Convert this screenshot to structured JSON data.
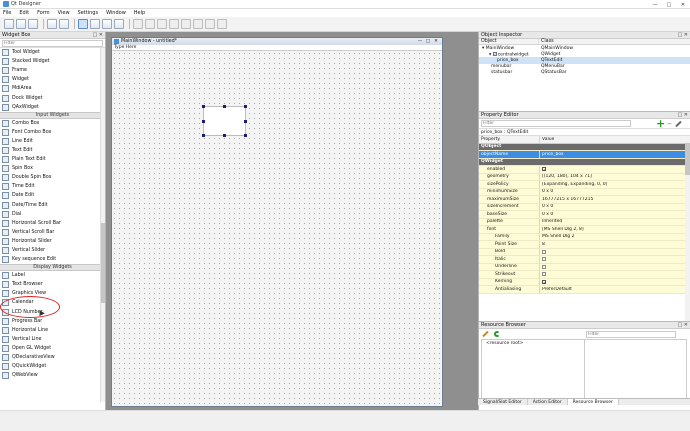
{
  "app": {
    "title": "Qt Designer"
  },
  "menu": [
    "File",
    "Edit",
    "Form",
    "View",
    "Settings",
    "Window",
    "Help"
  ],
  "widget_box": {
    "title": "Widget Box",
    "filter_placeholder": "Filter",
    "items_top": [
      "Tool Widget",
      "Stacked Widget",
      "Frame",
      "Widget",
      "MdiArea",
      "Dock Widget",
      "QAxWidget"
    ],
    "input_category": "Input Widgets",
    "input_items": [
      "Combo Box",
      "Font Combo Box",
      "Line Edit",
      "Text Edit",
      "Plain Text Edit",
      "Spin Box",
      "Double Spin Box",
      "Time Edit",
      "Date Edit",
      "Date/Time Edit",
      "Dial",
      "Horizontal Scroll Bar",
      "Vertical Scroll Bar",
      "Horizontal Slider",
      "Vertical Slider",
      "Key sequence Edit"
    ],
    "display_category": "Display Widgets",
    "display_items": [
      "Label",
      "Text Browser",
      "Graphics View",
      "Calendar",
      "LCD Number",
      "Progress Bar",
      "Horizontal Line",
      "Vertical Line",
      "Open GL Widget",
      "QDeclarativeView",
      "QQuickWidget",
      "QWebView"
    ]
  },
  "form": {
    "title": "MainWindow - untitled*",
    "type_here": "Type Here"
  },
  "object_inspector": {
    "title": "Object Inspector",
    "col_object": "Object",
    "col_class": "Class",
    "rows": [
      {
        "object": "MainWindow",
        "class": "QMainWindow"
      },
      {
        "object": "centralwidget",
        "class": "QWidget"
      },
      {
        "object": "price_box",
        "class": "QTextEdit"
      },
      {
        "object": "menubar",
        "class": "QMenuBar"
      },
      {
        "object": "statusbar",
        "class": "QStatusBar"
      }
    ]
  },
  "property_editor": {
    "title": "Property Editor",
    "filter_placeholder": "Filter",
    "object_line": "price_box : QTextEdit",
    "col_property": "Property",
    "col_value": "Value",
    "rows": [
      {
        "name": "QObject",
        "value": "",
        "kind": "cls"
      },
      {
        "name": "objectName",
        "value": "price_box",
        "kind": "sel"
      },
      {
        "name": "QWidget",
        "value": "",
        "kind": "cls"
      },
      {
        "name": "enabled",
        "value": "",
        "kind": "yellow",
        "check": true
      },
      {
        "name": "geometry",
        "value": "[(120, 180), 104 x 71]",
        "kind": "yellow"
      },
      {
        "name": "sizePolicy",
        "value": "[Expanding, Expanding, 0, 0]",
        "kind": "yellow"
      },
      {
        "name": "minimumSize",
        "value": "0 x 0",
        "kind": "yellow"
      },
      {
        "name": "maximumSize",
        "value": "16777215 x 16777215",
        "kind": "yellow"
      },
      {
        "name": "sizeIncrement",
        "value": "0 x 0",
        "kind": "yellow"
      },
      {
        "name": "baseSize",
        "value": "0 x 0",
        "kind": "yellow"
      },
      {
        "name": "palette",
        "value": "Inherited",
        "kind": "yellow"
      },
      {
        "name": "font",
        "value": "[MS Shell Dlg 2, 8]",
        "kind": "yellow"
      },
      {
        "name": "Family",
        "value": "MS Shell Dlg 2",
        "kind": "yellow"
      },
      {
        "name": "Point Size",
        "value": "8",
        "kind": "yellow"
      },
      {
        "name": "Bold",
        "value": "",
        "kind": "yellow",
        "check": false
      },
      {
        "name": "Italic",
        "value": "",
        "kind": "yellow",
        "check": false
      },
      {
        "name": "Underline",
        "value": "",
        "kind": "yellow",
        "check": false
      },
      {
        "name": "Strikeout",
        "value": "",
        "kind": "yellow",
        "check": false
      },
      {
        "name": "Kerning",
        "value": "",
        "kind": "yellow",
        "check": true
      },
      {
        "name": "Antialiasing",
        "value": "PreferDefault",
        "kind": "yellow"
      }
    ]
  },
  "resource_browser": {
    "title": "Resource Browser",
    "filter_placeholder": "Filter",
    "root": "<resource root>"
  },
  "bottom_tabs": [
    "Signal/Slot Editor",
    "Action Editor",
    "Resource Browser"
  ],
  "colors": {
    "accent": "#3d8ee2",
    "annotation": "#d22222"
  }
}
